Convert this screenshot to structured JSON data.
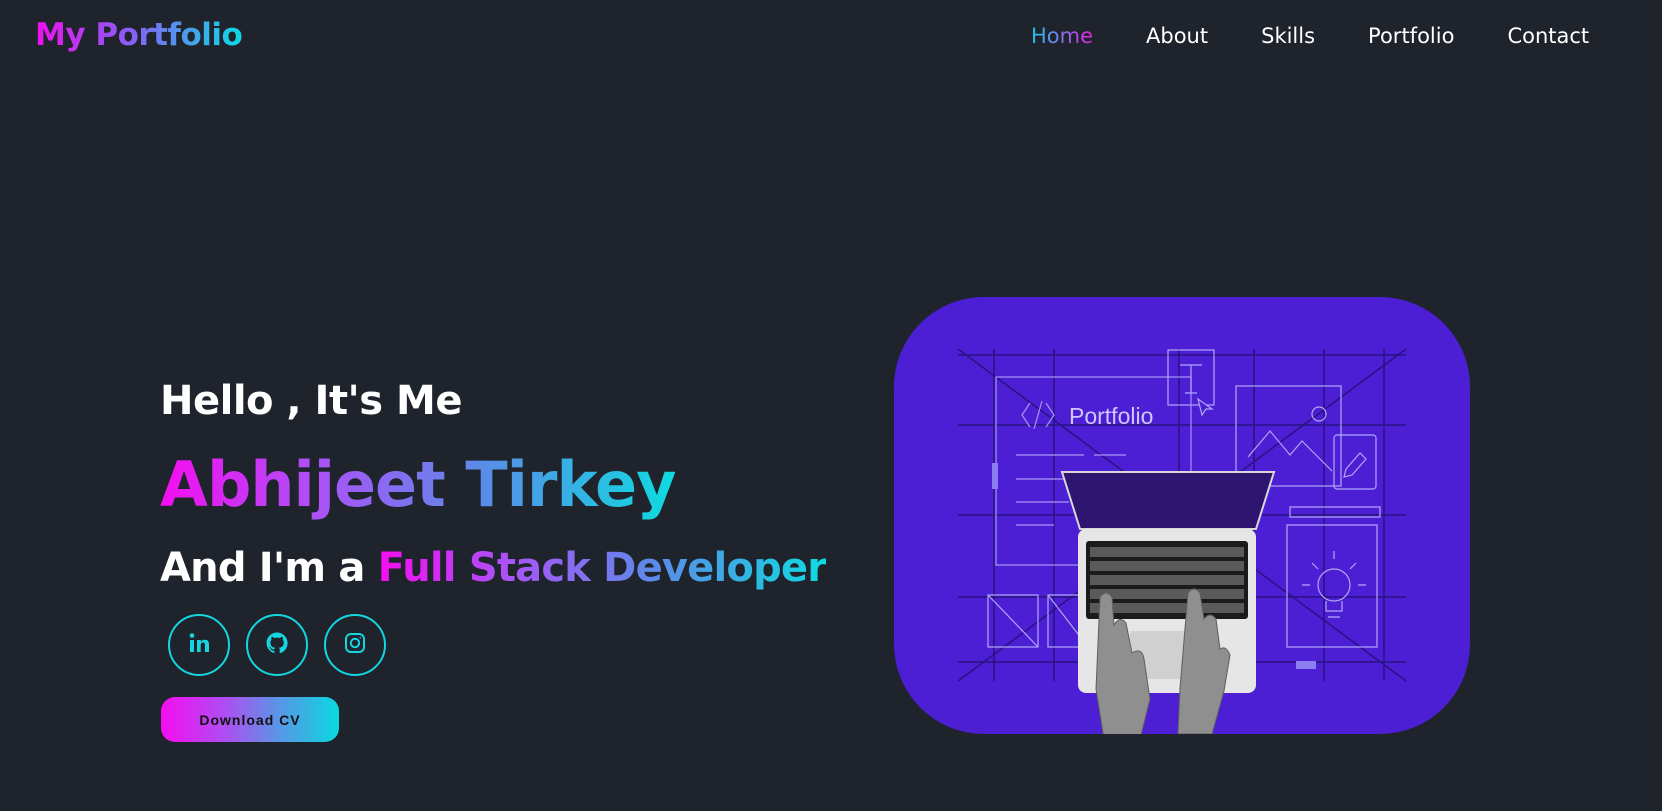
{
  "header": {
    "logo": "My Portfolio",
    "nav": [
      "Home",
      "About",
      "Skills",
      "Portfolio",
      "Contact"
    ],
    "active_nav": "Home"
  },
  "hero": {
    "greeting": "Hello , It's Me",
    "name": "Abhijeet Tirkey",
    "role_prefix": "And I'm a ",
    "role_title": "Full Stack Developer",
    "cv_button": "Download CV",
    "illustration_label": "Portfolio"
  },
  "socials": [
    {
      "icon": "linkedin-icon"
    },
    {
      "icon": "github-icon"
    },
    {
      "icon": "instagram-icon"
    }
  ],
  "colors": {
    "background": "#1f232c",
    "accent_pink": "#f50df0",
    "accent_cyan": "#0edbe0",
    "illustration_bg": "#4c1fd4"
  }
}
